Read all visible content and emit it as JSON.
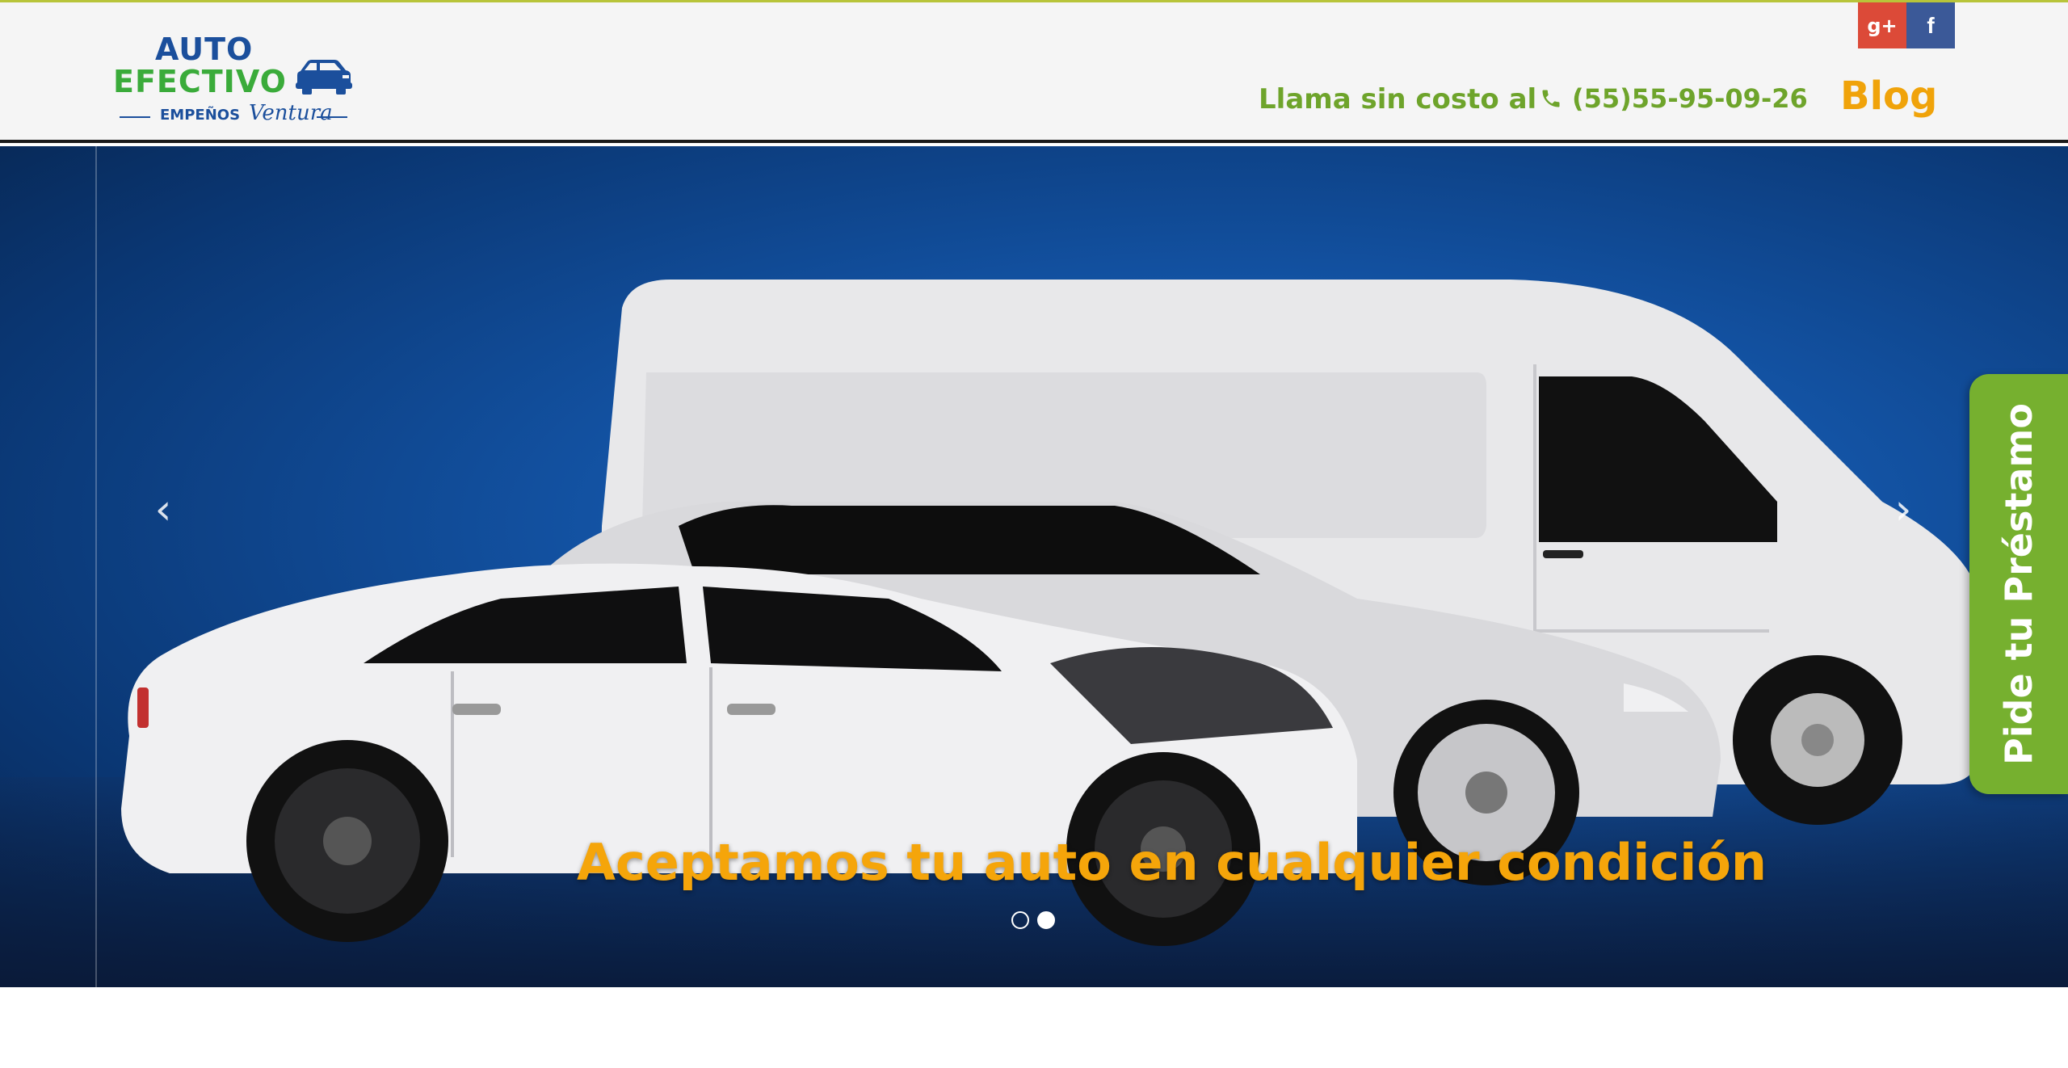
{
  "brand": {
    "line1": "AUTO",
    "line2": "EFECTIVO",
    "sub1": "EMPEÑOS",
    "sub2": "Ventura"
  },
  "social": [
    {
      "name": "google-plus",
      "glyph": "g+"
    },
    {
      "name": "facebook",
      "glyph": "f"
    }
  ],
  "header": {
    "contact_label": "Llama sin costo al",
    "phone": "(55)55-95-09-26",
    "blog": "Blog"
  },
  "hero": {
    "caption": "Aceptamos tu auto en cualquier condición",
    "prev_glyph": "‹",
    "next_glyph": "›",
    "slides": 2,
    "active_slide": 2
  },
  "side_tab": {
    "label": "Pide tu Préstamo"
  },
  "colors": {
    "brand_blue": "#1b4f9c",
    "brand_green": "#3aab3a",
    "accent_green": "#6ea42b",
    "accent_orange": "#f0a30a",
    "tab_green": "#76b02f",
    "gplus_red": "#dc4a38",
    "facebook_blue": "#3b5998"
  }
}
